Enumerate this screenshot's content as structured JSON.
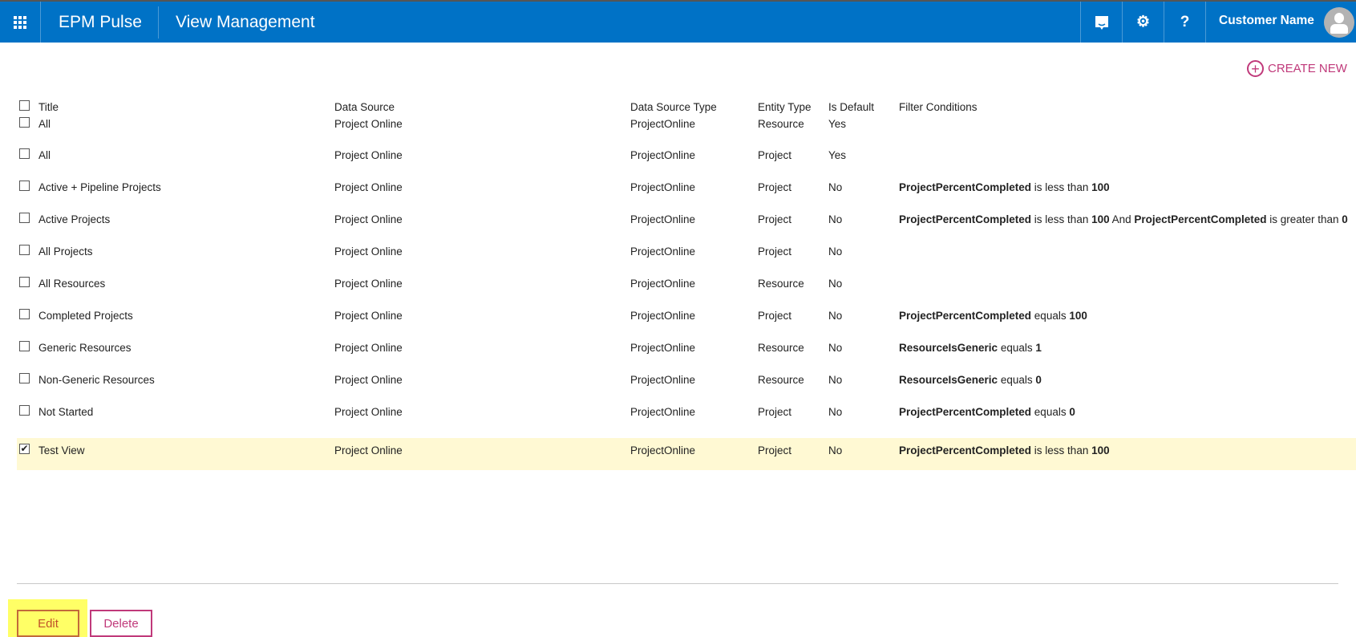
{
  "header": {
    "app_name": "EPM Pulse",
    "page_title": "View Management",
    "user_name": "Customer Name",
    "icons": [
      "waffle-icon",
      "feedback-icon",
      "gear-icon",
      "help-icon",
      "avatar-icon"
    ],
    "help_label": "?"
  },
  "create_new": "CREATE NEW",
  "columns": [
    "Title",
    "Data Source",
    "Data Source Type",
    "Entity Type",
    "Is Default",
    "Filter Conditions"
  ],
  "rows": [
    {
      "title": "All",
      "source": "Project Online",
      "type": "ProjectOnline",
      "entity": "Resource",
      "default": "Yes",
      "filter": [],
      "checked": false
    },
    {
      "title": "All",
      "source": "Project Online",
      "type": "ProjectOnline",
      "entity": "Project",
      "default": "Yes",
      "filter": [],
      "checked": false
    },
    {
      "title": "Active + Pipeline Projects",
      "source": "Project Online",
      "type": "ProjectOnline",
      "entity": "Project",
      "default": "No",
      "filter": [
        [
          "ProjectPercentCompleted",
          1
        ],
        " is less than ",
        [
          "100",
          1
        ]
      ],
      "checked": false
    },
    {
      "title": "Active Projects",
      "source": "Project Online",
      "type": "ProjectOnline",
      "entity": "Project",
      "default": "No",
      "filter": [
        [
          "ProjectPercentCompleted",
          1
        ],
        " is less than ",
        [
          "100",
          1
        ],
        " And ",
        [
          "ProjectPercentCompleted",
          1
        ],
        " is greater than ",
        [
          "0",
          1
        ]
      ],
      "checked": false
    },
    {
      "title": "All Projects",
      "source": "Project Online",
      "type": "ProjectOnline",
      "entity": "Project",
      "default": "No",
      "filter": [],
      "checked": false
    },
    {
      "title": "All Resources",
      "source": "Project Online",
      "type": "ProjectOnline",
      "entity": "Resource",
      "default": "No",
      "filter": [],
      "checked": false
    },
    {
      "title": "Completed Projects",
      "source": "Project Online",
      "type": "ProjectOnline",
      "entity": "Project",
      "default": "No",
      "filter": [
        [
          "ProjectPercentCompleted",
          1
        ],
        " equals ",
        [
          "100",
          1
        ]
      ],
      "checked": false
    },
    {
      "title": "Generic Resources",
      "source": "Project Online",
      "type": "ProjectOnline",
      "entity": "Resource",
      "default": "No",
      "filter": [
        [
          "ResourceIsGeneric",
          1
        ],
        " equals ",
        [
          "1",
          1
        ]
      ],
      "checked": false
    },
    {
      "title": "Non-Generic Resources",
      "source": "Project Online",
      "type": "ProjectOnline",
      "entity": "Resource",
      "default": "No",
      "filter": [
        [
          "ResourceIsGeneric",
          1
        ],
        " equals ",
        [
          "0",
          1
        ]
      ],
      "checked": false
    },
    {
      "title": "Not Started",
      "source": "Project Online",
      "type": "ProjectOnline",
      "entity": "Project",
      "default": "No",
      "filter": [
        [
          "ProjectPercentCompleted",
          1
        ],
        " equals ",
        [
          "0",
          1
        ]
      ],
      "checked": false
    },
    {
      "title": "Test View",
      "source": "Project Online",
      "type": "ProjectOnline",
      "entity": "Project",
      "default": "No",
      "filter": [
        [
          "ProjectPercentCompleted",
          1
        ],
        " is less than ",
        [
          "100",
          1
        ]
      ],
      "checked": true
    }
  ],
  "buttons": {
    "edit": "Edit",
    "delete": "Delete"
  },
  "colors": {
    "header": "#0072c6",
    "accent": "#c0397a",
    "selected_row": "#fff9d3"
  }
}
